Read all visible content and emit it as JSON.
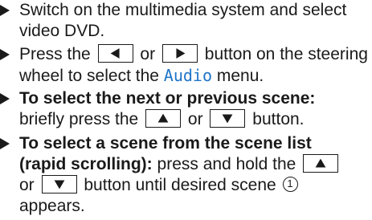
{
  "steps": [
    {
      "line1": "Switch on the multimedia system and select",
      "line2": "video DVD."
    },
    {
      "pre": "Press the",
      "btn_left": "left-arrow",
      "or": "or",
      "btn_right": "right-arrow",
      "post": "button on the steering",
      "line2_pre": "wheel to select the",
      "menu": "Audio",
      "line2_post": "menu."
    },
    {
      "bold": "To select the next or previous scene:",
      "pre": "briefly press the",
      "btn_up": "up-arrow",
      "or": "or",
      "btn_down": "down-arrow",
      "post": "button."
    },
    {
      "bold1": "To select a scene from the scene list",
      "bold2": "(rapid scrolling):",
      "pre": "press and hold the",
      "btn_up": "up-arrow",
      "line3_pre": "or",
      "btn_down": "down-arrow",
      "line3_post": "button until desired scene",
      "marker": "1",
      "line4": "appears."
    }
  ]
}
